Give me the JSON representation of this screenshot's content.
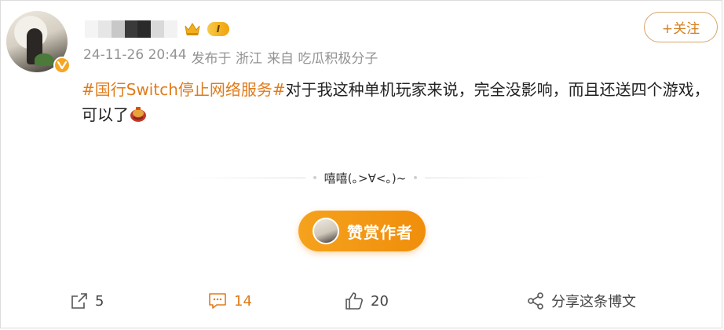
{
  "post": {
    "author": {
      "name": "",
      "level_badge": "I"
    },
    "meta": {
      "timestamp": "24-11-26 20:44",
      "location": "发布于 浙江",
      "source": "来自 吃瓜积极分子"
    },
    "follow_label": "+关注",
    "content": {
      "hashtag": "#国行Switch停止网络服务#",
      "text": "对于我这种单机玩家来说，完全没影响，而且还送四个游戏，可以了"
    },
    "divider_text": "嘻嘻(｡>∀<｡)~",
    "reward_label": "赞赏作者"
  },
  "actions": {
    "repost_count": "5",
    "comment_count": "14",
    "like_count": "20",
    "share_label": "分享这条博文"
  },
  "colors": {
    "accent": "#e07b1a",
    "reward_bg": "#f5a21d",
    "meta_text": "#939393"
  },
  "icons": [
    "verified-icon",
    "crown-icon",
    "repost-icon",
    "comment-icon",
    "like-icon",
    "share-icon",
    "emoji-icon"
  ]
}
